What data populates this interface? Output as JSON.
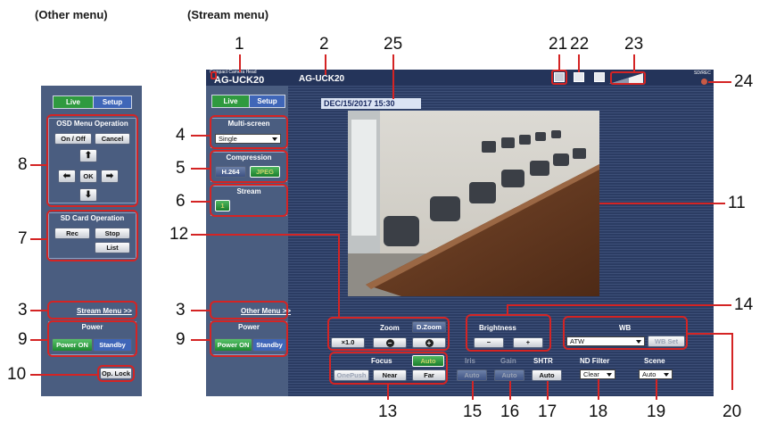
{
  "headers": {
    "other": "(Other menu)",
    "stream": "(Stream menu)"
  },
  "callouts": [
    "1",
    "2",
    "25",
    "21",
    "22",
    "23",
    "24",
    "4",
    "5",
    "6",
    "11",
    "12",
    "14",
    "3",
    "3",
    "9",
    "9",
    "8",
    "7",
    "10",
    "13",
    "15",
    "16",
    "17",
    "18",
    "19",
    "20"
  ],
  "other_menu": {
    "tabs": {
      "live": "Live",
      "setup": "Setup"
    },
    "osd": {
      "title": "OSD Menu Operation",
      "on_off": "On / Off",
      "cancel": "Cancel",
      "ok": "OK"
    },
    "sd": {
      "title": "SD Card Operation",
      "rec": "Rec",
      "stop": "Stop",
      "list": "List"
    },
    "stream_menu_link": "Stream Menu >>",
    "power": {
      "title": "Power",
      "on": "Power ON",
      "standby": "Standby"
    },
    "op_lock": "Op. Lock"
  },
  "stream_menu": {
    "brand_small": "Compact Camera Head",
    "brand": "AG-UCK20",
    "model": "AG-UCK20",
    "sd_rec": "SD/REC",
    "tabs": {
      "live": "Live",
      "setup": "Setup"
    },
    "multiscreen": {
      "title": "Multi-screen",
      "value": "Single"
    },
    "compression": {
      "title": "Compression",
      "h264": "H.264",
      "jpeg": "JPEG"
    },
    "stream": {
      "title": "Stream",
      "button": "1"
    },
    "other_menu_link": "Other Menu >>",
    "power": {
      "title": "Power",
      "on": "Power ON",
      "standby": "Standby"
    },
    "datetime": "DEC/15/2017   15:30",
    "zoom": {
      "label": "Zoom",
      "dzoom": "D.Zoom",
      "x1": "×1.0",
      "minus": "−",
      "plus": "+"
    },
    "brightness": {
      "label": "Brightness",
      "minus": "−",
      "plus": "+"
    },
    "wb": {
      "label": "WB",
      "value": "ATW",
      "set": "WB Set"
    },
    "focus": {
      "label": "Focus",
      "auto": "Auto",
      "onepush": "OnePush",
      "near": "Near",
      "far": "Far"
    },
    "iris": {
      "label": "Iris",
      "auto": "Auto"
    },
    "gain": {
      "label": "Gain",
      "auto": "Auto"
    },
    "shtr": {
      "label": "SHTR",
      "auto": "Auto"
    },
    "nd": {
      "label": "ND Filter",
      "value": "Clear"
    },
    "scene": {
      "label": "Scene",
      "value": "Auto"
    }
  }
}
